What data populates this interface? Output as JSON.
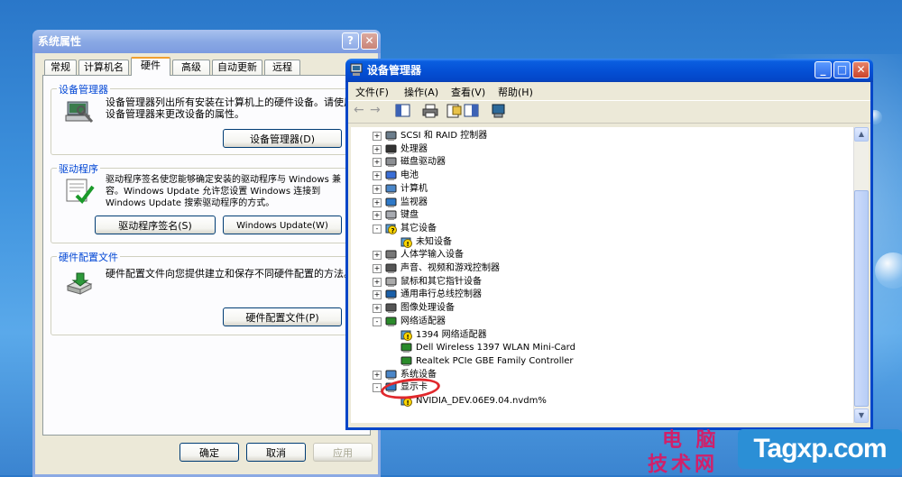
{
  "system_properties": {
    "title": "系统属性",
    "tabs": [
      "常规",
      "计算机名",
      "硬件",
      "高级",
      "自动更新",
      "远程"
    ],
    "selected_tab": "硬件",
    "device_manager_group": {
      "title": "设备管理器",
      "text": "设备管理器列出所有安装在计算机上的硬件设备。请使用设备管理器来更改设备的属性。",
      "button": "设备管理器(D)"
    },
    "driver_group": {
      "title": "驱动程序",
      "text": "驱动程序签名使您能够确定安装的驱动程序与 Windows 兼容。Windows Update 允许您设置 Windows 连接到 Windows Update 搜索驱动程序的方式。",
      "button_signing": "驱动程序签名(S)",
      "button_update": "Windows Update(W)"
    },
    "profile_group": {
      "title": "硬件配置文件",
      "text": "硬件配置文件向您提供建立和保存不同硬件配置的方法。",
      "button": "硬件配置文件(P)"
    },
    "ok": "确定",
    "cancel": "取消",
    "apply": "应用"
  },
  "device_manager": {
    "title": "设备管理器",
    "menu": [
      "文件(F)",
      "操作(A)",
      "查看(V)",
      "帮助(H)"
    ],
    "tree": [
      {
        "label": "SCSI 和 RAID 控制器",
        "level": 0,
        "expander": "+",
        "icon": "scsi-icon"
      },
      {
        "label": "处理器",
        "level": 0,
        "expander": "+",
        "icon": "cpu-icon"
      },
      {
        "label": "磁盘驱动器",
        "level": 0,
        "expander": "+",
        "icon": "disk-icon"
      },
      {
        "label": "电池",
        "level": 0,
        "expander": "+",
        "icon": "battery-icon"
      },
      {
        "label": "计算机",
        "level": 0,
        "expander": "+",
        "icon": "computer-icon"
      },
      {
        "label": "监视器",
        "level": 0,
        "expander": "+",
        "icon": "monitor-icon"
      },
      {
        "label": "键盘",
        "level": 0,
        "expander": "+",
        "icon": "keyboard-icon"
      },
      {
        "label": "其它设备",
        "level": 0,
        "expander": "-",
        "icon": "unknown-device-icon"
      },
      {
        "label": "未知设备",
        "level": 1,
        "expander": "",
        "icon": "warning-device-icon"
      },
      {
        "label": "人体学输入设备",
        "level": 0,
        "expander": "+",
        "icon": "hid-icon"
      },
      {
        "label": "声音、视频和游戏控制器",
        "level": 0,
        "expander": "+",
        "icon": "sound-icon"
      },
      {
        "label": "鼠标和其它指针设备",
        "level": 0,
        "expander": "+",
        "icon": "mouse-icon"
      },
      {
        "label": "通用串行总线控制器",
        "level": 0,
        "expander": "+",
        "icon": "usb-icon"
      },
      {
        "label": "图像处理设备",
        "level": 0,
        "expander": "+",
        "icon": "camera-icon"
      },
      {
        "label": "网络适配器",
        "level": 0,
        "expander": "-",
        "icon": "network-icon"
      },
      {
        "label": "1394 网络适配器",
        "level": 1,
        "expander": "",
        "icon": "network-warning-icon"
      },
      {
        "label": "Dell Wireless 1397 WLAN Mini-Card",
        "level": 1,
        "expander": "",
        "icon": "network-card-icon"
      },
      {
        "label": "Realtek PCIe GBE Family Controller",
        "level": 1,
        "expander": "",
        "icon": "network-card-icon"
      },
      {
        "label": "系统设备",
        "level": 0,
        "expander": "+",
        "icon": "system-icon"
      },
      {
        "label": "显示卡",
        "level": 0,
        "expander": "-",
        "icon": "display-icon"
      },
      {
        "label": "NVIDIA_DEV.06E9.04.nvdm%",
        "level": 1,
        "expander": "",
        "icon": "display-warning-icon"
      }
    ]
  },
  "watermark": {
    "line1": "电 脑",
    "line2": "技术网",
    "logo": "Tagxp.com"
  },
  "colors": {
    "highlight_ellipse": "#e0282c",
    "group_title": "#0046d5",
    "active_title": "#0551d6",
    "inactive_title": "#8aa9e4"
  }
}
